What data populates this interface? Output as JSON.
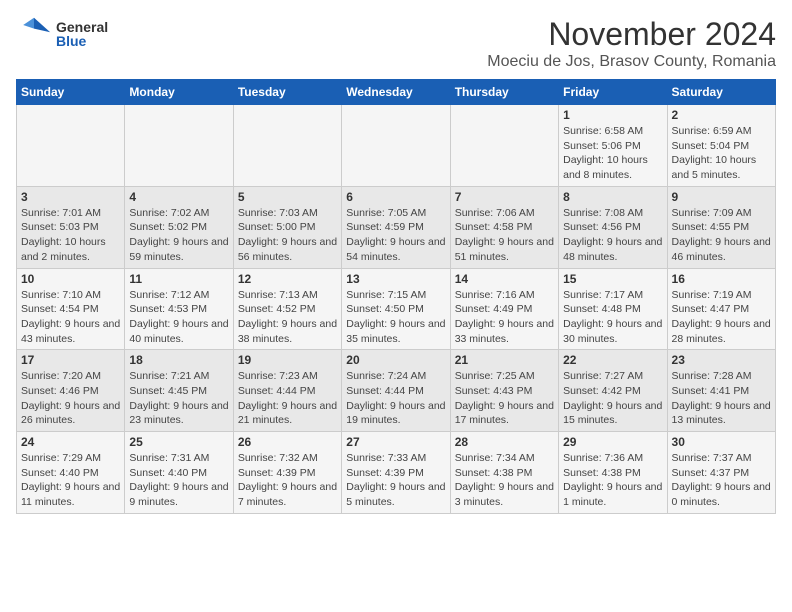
{
  "header": {
    "logo_general": "General",
    "logo_blue": "Blue",
    "month": "November 2024",
    "location": "Moeciu de Jos, Brasov County, Romania"
  },
  "days_of_week": [
    "Sunday",
    "Monday",
    "Tuesday",
    "Wednesday",
    "Thursday",
    "Friday",
    "Saturday"
  ],
  "weeks": [
    [
      {
        "day": "",
        "info": ""
      },
      {
        "day": "",
        "info": ""
      },
      {
        "day": "",
        "info": ""
      },
      {
        "day": "",
        "info": ""
      },
      {
        "day": "",
        "info": ""
      },
      {
        "day": "1",
        "info": "Sunrise: 6:58 AM\nSunset: 5:06 PM\nDaylight: 10 hours and 8 minutes."
      },
      {
        "day": "2",
        "info": "Sunrise: 6:59 AM\nSunset: 5:04 PM\nDaylight: 10 hours and 5 minutes."
      }
    ],
    [
      {
        "day": "3",
        "info": "Sunrise: 7:01 AM\nSunset: 5:03 PM\nDaylight: 10 hours and 2 minutes."
      },
      {
        "day": "4",
        "info": "Sunrise: 7:02 AM\nSunset: 5:02 PM\nDaylight: 9 hours and 59 minutes."
      },
      {
        "day": "5",
        "info": "Sunrise: 7:03 AM\nSunset: 5:00 PM\nDaylight: 9 hours and 56 minutes."
      },
      {
        "day": "6",
        "info": "Sunrise: 7:05 AM\nSunset: 4:59 PM\nDaylight: 9 hours and 54 minutes."
      },
      {
        "day": "7",
        "info": "Sunrise: 7:06 AM\nSunset: 4:58 PM\nDaylight: 9 hours and 51 minutes."
      },
      {
        "day": "8",
        "info": "Sunrise: 7:08 AM\nSunset: 4:56 PM\nDaylight: 9 hours and 48 minutes."
      },
      {
        "day": "9",
        "info": "Sunrise: 7:09 AM\nSunset: 4:55 PM\nDaylight: 9 hours and 46 minutes."
      }
    ],
    [
      {
        "day": "10",
        "info": "Sunrise: 7:10 AM\nSunset: 4:54 PM\nDaylight: 9 hours and 43 minutes."
      },
      {
        "day": "11",
        "info": "Sunrise: 7:12 AM\nSunset: 4:53 PM\nDaylight: 9 hours and 40 minutes."
      },
      {
        "day": "12",
        "info": "Sunrise: 7:13 AM\nSunset: 4:52 PM\nDaylight: 9 hours and 38 minutes."
      },
      {
        "day": "13",
        "info": "Sunrise: 7:15 AM\nSunset: 4:50 PM\nDaylight: 9 hours and 35 minutes."
      },
      {
        "day": "14",
        "info": "Sunrise: 7:16 AM\nSunset: 4:49 PM\nDaylight: 9 hours and 33 minutes."
      },
      {
        "day": "15",
        "info": "Sunrise: 7:17 AM\nSunset: 4:48 PM\nDaylight: 9 hours and 30 minutes."
      },
      {
        "day": "16",
        "info": "Sunrise: 7:19 AM\nSunset: 4:47 PM\nDaylight: 9 hours and 28 minutes."
      }
    ],
    [
      {
        "day": "17",
        "info": "Sunrise: 7:20 AM\nSunset: 4:46 PM\nDaylight: 9 hours and 26 minutes."
      },
      {
        "day": "18",
        "info": "Sunrise: 7:21 AM\nSunset: 4:45 PM\nDaylight: 9 hours and 23 minutes."
      },
      {
        "day": "19",
        "info": "Sunrise: 7:23 AM\nSunset: 4:44 PM\nDaylight: 9 hours and 21 minutes."
      },
      {
        "day": "20",
        "info": "Sunrise: 7:24 AM\nSunset: 4:44 PM\nDaylight: 9 hours and 19 minutes."
      },
      {
        "day": "21",
        "info": "Sunrise: 7:25 AM\nSunset: 4:43 PM\nDaylight: 9 hours and 17 minutes."
      },
      {
        "day": "22",
        "info": "Sunrise: 7:27 AM\nSunset: 4:42 PM\nDaylight: 9 hours and 15 minutes."
      },
      {
        "day": "23",
        "info": "Sunrise: 7:28 AM\nSunset: 4:41 PM\nDaylight: 9 hours and 13 minutes."
      }
    ],
    [
      {
        "day": "24",
        "info": "Sunrise: 7:29 AM\nSunset: 4:40 PM\nDaylight: 9 hours and 11 minutes."
      },
      {
        "day": "25",
        "info": "Sunrise: 7:31 AM\nSunset: 4:40 PM\nDaylight: 9 hours and 9 minutes."
      },
      {
        "day": "26",
        "info": "Sunrise: 7:32 AM\nSunset: 4:39 PM\nDaylight: 9 hours and 7 minutes."
      },
      {
        "day": "27",
        "info": "Sunrise: 7:33 AM\nSunset: 4:39 PM\nDaylight: 9 hours and 5 minutes."
      },
      {
        "day": "28",
        "info": "Sunrise: 7:34 AM\nSunset: 4:38 PM\nDaylight: 9 hours and 3 minutes."
      },
      {
        "day": "29",
        "info": "Sunrise: 7:36 AM\nSunset: 4:38 PM\nDaylight: 9 hours and 1 minute."
      },
      {
        "day": "30",
        "info": "Sunrise: 7:37 AM\nSunset: 4:37 PM\nDaylight: 9 hours and 0 minutes."
      }
    ]
  ]
}
